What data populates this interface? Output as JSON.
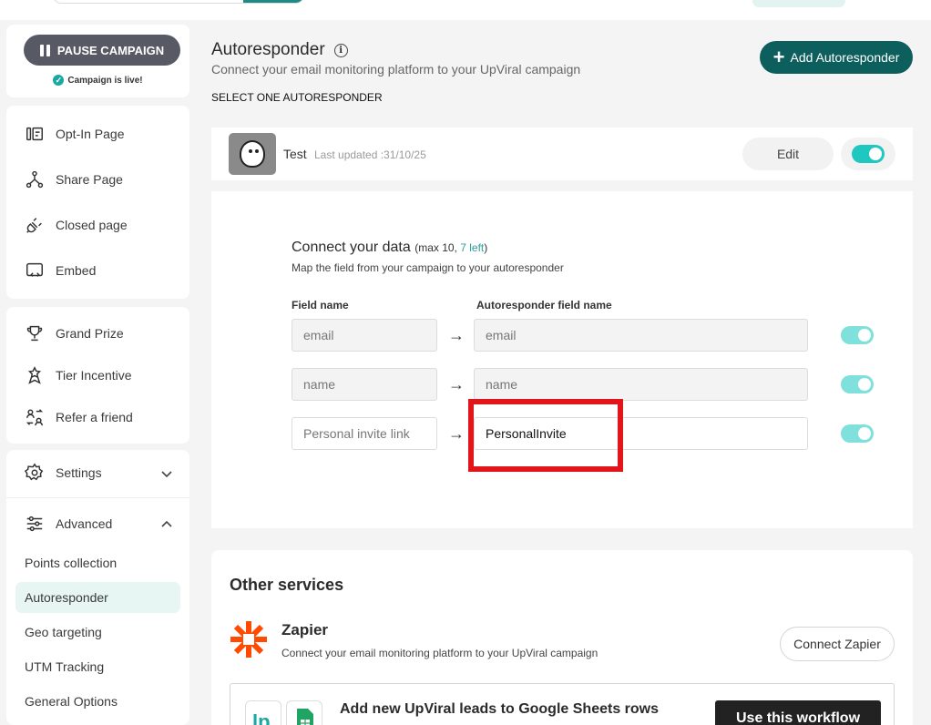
{
  "sidebar": {
    "pause_label": "PAUSE CAMPAIGN",
    "live_label": "Campaign is live!",
    "pages": [
      {
        "label": "Opt-In Page"
      },
      {
        "label": "Share Page"
      },
      {
        "label": "Closed page"
      },
      {
        "label": "Embed"
      }
    ],
    "rewards": [
      {
        "label": "Grand Prize"
      },
      {
        "label": "Tier Incentive"
      },
      {
        "label": "Refer a friend"
      }
    ],
    "settings_label": "Settings",
    "advanced_label": "Advanced",
    "advanced_items": [
      {
        "label": "Points collection"
      },
      {
        "label": "Autoresponder"
      },
      {
        "label": "Geo targeting"
      },
      {
        "label": "UTM Tracking"
      },
      {
        "label": "General Options"
      }
    ]
  },
  "header": {
    "title": "Autoresponder",
    "subtitle": "Connect your email monitoring platform to your UpViral campaign",
    "select_label": "SELECT ONE AUTORESPONDER",
    "add_label": "Add Autoresponder"
  },
  "autoresponder": {
    "name": "Test",
    "updated": "Last updated :31/10/25",
    "edit_label": "Edit",
    "enabled": true
  },
  "connect": {
    "title": "Connect your data",
    "max_prefix": "(max 10, ",
    "left_text": "7 left",
    "max_suffix": ")",
    "description": "Map the field from your campaign to your autoresponder",
    "col_field": "Field name",
    "col_ar_field": "Autoresponder field name",
    "rows": [
      {
        "field": "email",
        "ar_field": "email",
        "enabled": true
      },
      {
        "field": "name",
        "ar_field": "name",
        "enabled": true
      },
      {
        "field": "Personal invite link",
        "ar_field": "PersonalInvite",
        "enabled": true
      }
    ]
  },
  "other_services": {
    "title": "Other services",
    "zapier_name": "Zapier",
    "zapier_desc": "Connect your email monitoring platform to your UpViral campaign",
    "zapier_button": "Connect Zapier",
    "workflow_title": "Add new UpViral leads to Google Sheets rows",
    "workflow_button": "Use this workflow"
  },
  "colors": {
    "accent": "#1ec7c0",
    "brand_dark": "#0d5f5d",
    "highlight": "#e2151b",
    "zapier": "#ff4a00"
  }
}
